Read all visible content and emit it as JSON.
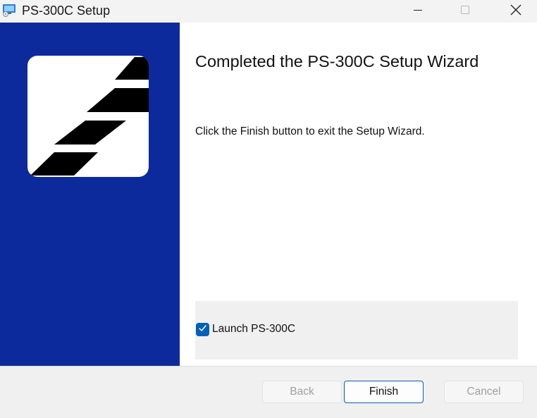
{
  "window": {
    "title": "PS-300C Setup",
    "icon": "setup-installer-icon"
  },
  "titlebar_controls": {
    "minimize_icon": "minimize-icon",
    "maximize_icon": "maximize-icon",
    "close_icon": "close-icon"
  },
  "banner": {
    "background_color": "#0c2a9c",
    "logo_icon": "diagonal-stripes-logo"
  },
  "content": {
    "heading": "Completed the PS-300C Setup Wizard",
    "body": "Click the Finish button to exit the Setup Wizard."
  },
  "launch_option": {
    "label": "Launch PS-300C",
    "checked": true
  },
  "buttons": {
    "back": "Back",
    "finish": "Finish",
    "cancel": "Cancel"
  },
  "colors": {
    "accent": "#005fb8",
    "disabled_text": "#a0a0a0"
  }
}
